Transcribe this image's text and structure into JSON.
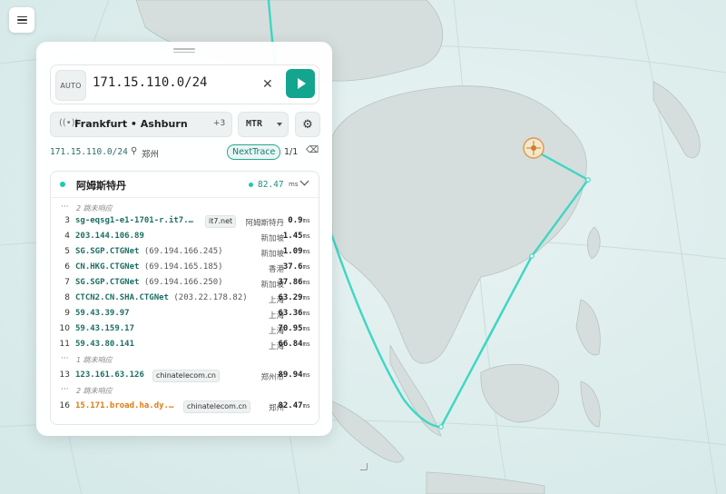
{
  "search": {
    "mode_badge": "AUTO",
    "query": "171.15.110.0/24"
  },
  "controls": {
    "nodes_label": "Frankfurt • Ashburn",
    "nodes_more": "+3",
    "protocol": "MTR"
  },
  "meta": {
    "target": "171.15.110.0/24",
    "city": "郑州",
    "provider_badge": "NextTrace",
    "page": "1/1"
  },
  "result": {
    "node_name": "阿姆斯特丹",
    "latency": "82.47",
    "latency_unit": "ms",
    "rows": [
      {
        "kind": "noresp",
        "text": "2 跳未响应"
      },
      {
        "kind": "hop",
        "num": "3",
        "host": "sg-eqsg1-e1-1701-r.it7.…",
        "tag": "it7.net",
        "loc": "阿姆斯特丹",
        "rtt": "0.9",
        "unit": "ms"
      },
      {
        "kind": "hop",
        "num": "4",
        "host": "203.144.106.89",
        "loc": "新加坡",
        "rtt": "1.45",
        "unit": "ms"
      },
      {
        "kind": "hop",
        "num": "5",
        "host": "SG.SGP.CTGNet",
        "ip": "(69.194.166.245)",
        "loc": "新加坡",
        "rtt": "1.09",
        "unit": "ms"
      },
      {
        "kind": "hop",
        "num": "6",
        "host": "CN.HKG.CTGNet",
        "ip": "(69.194.165.185)",
        "loc": "香港",
        "rtt": "37.6",
        "unit": "ms"
      },
      {
        "kind": "hop",
        "num": "7",
        "host": "SG.SGP.CTGNet",
        "ip": "(69.194.166.250)",
        "loc": "新加坡",
        "rtt": "37.86",
        "unit": "ms"
      },
      {
        "kind": "hop",
        "num": "8",
        "host": "CTCN2.CN.SHA.CTGNet",
        "ip": "(203.22.178.82)",
        "loc": "上海",
        "rtt": "63.29",
        "unit": "ms"
      },
      {
        "kind": "hop",
        "num": "9",
        "host": "59.43.39.97",
        "loc": "上海",
        "rtt": "63.36",
        "unit": "ms"
      },
      {
        "kind": "hop",
        "num": "10",
        "host": "59.43.159.17",
        "loc": "上海",
        "rtt": "70.95",
        "unit": "ms"
      },
      {
        "kind": "hop",
        "num": "11",
        "host": "59.43.80.141",
        "loc": "上海",
        "rtt": "66.84",
        "unit": "ms"
      },
      {
        "kind": "noresp",
        "text": "1 跳未响应"
      },
      {
        "kind": "hop",
        "num": "13",
        "host": "123.161.63.126",
        "tag": "chinatelecom.cn",
        "loc": "郑州市",
        "rtt": "89.94",
        "unit": "ms"
      },
      {
        "kind": "noresp",
        "text": "2 跳未响应"
      },
      {
        "kind": "hop",
        "num": "16",
        "host": "15.171.broad.ha.dy.…",
        "tag": "chinatelecom.cn",
        "loc": "郑州",
        "rtt": "82.47",
        "unit": "ms",
        "highlight": true
      }
    ]
  },
  "colors": {
    "accent": "#14a58f",
    "route": "#3fd6c4",
    "land": "#d6dedd",
    "sea": "#dfeeee",
    "highlight": "#e07a10"
  },
  "icons": [
    "menu-icon",
    "clear-icon",
    "play-icon",
    "antenna-icon",
    "chevron-down-icon",
    "gear-icon",
    "map-pin-icon",
    "eraser-icon",
    "resize-handle-icon",
    "origin-marker-icon"
  ]
}
